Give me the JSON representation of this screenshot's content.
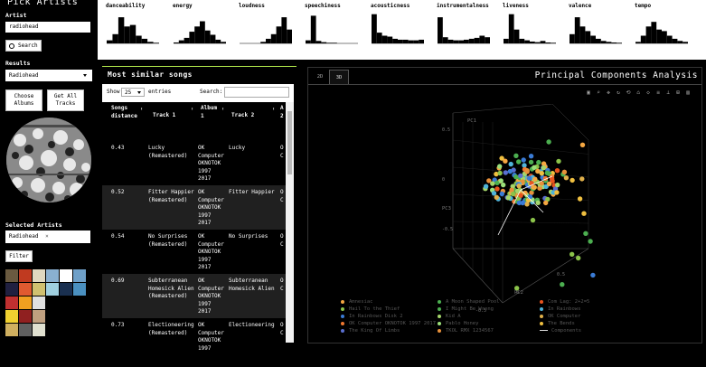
{
  "sidebar": {
    "title": "Pick Artists",
    "artist_label": "Artist",
    "artist_value": "radiohead",
    "search_button": "Search",
    "results_label": "Results",
    "results_selected": "Radiohead",
    "choose_albums": "Choose\nAlbums",
    "get_all_tracks": "Get All\nTracks",
    "selected_artists_label": "Selected Artists",
    "selected_artist_chip": "Radiohead",
    "chip_remove": "×",
    "filter_button": "Filter"
  },
  "histograms": [
    {
      "label": "danceability",
      "bins": [
        0.1,
        0.3,
        0.85,
        0.55,
        0.6,
        0.25,
        0.15,
        0.05,
        0.02
      ]
    },
    {
      "label": "energy",
      "bins": [
        0.03,
        0.1,
        0.18,
        0.38,
        0.55,
        0.72,
        0.42,
        0.28,
        0.12,
        0.05
      ]
    },
    {
      "label": "loudness",
      "bins": [
        0.0,
        0.0,
        0.0,
        0.0,
        0.05,
        0.15,
        0.3,
        0.55,
        0.85,
        0.45
      ]
    },
    {
      "label": "speechiness",
      "bins": [
        0.1,
        0.9,
        0.08,
        0.04,
        0.02,
        0.02,
        0.0,
        0.0,
        0.0,
        0.0
      ]
    },
    {
      "label": "acousticness",
      "bins": [
        0.95,
        0.35,
        0.25,
        0.22,
        0.15,
        0.12,
        0.12,
        0.1,
        0.1,
        0.12
      ]
    },
    {
      "label": "instrumentalness",
      "bins": [
        0.85,
        0.2,
        0.12,
        0.1,
        0.1,
        0.12,
        0.15,
        0.18,
        0.25,
        0.2
      ]
    },
    {
      "label": "liveness",
      "bins": [
        0.15,
        0.95,
        0.45,
        0.15,
        0.1,
        0.06,
        0.04,
        0.08,
        0.03,
        0.02
      ]
    },
    {
      "label": "valence",
      "bins": [
        0.3,
        0.85,
        0.55,
        0.4,
        0.25,
        0.15,
        0.08,
        0.05,
        0.03,
        0.02
      ]
    },
    {
      "label": "tempo",
      "bins": [
        0.05,
        0.25,
        0.55,
        0.7,
        0.45,
        0.4,
        0.25,
        0.15,
        0.08,
        0.05
      ]
    }
  ],
  "songs_panel": {
    "title": "Most similar songs",
    "show_label": "Show",
    "page_size": "25",
    "entries_label": "entries",
    "search_label": "Search:",
    "columns": [
      "Songs\ndistance",
      "Track 1",
      "Album\n1",
      "Track 2",
      "A\n2"
    ],
    "rows": [
      {
        "distance": "0.43",
        "track1": "Lucky\n(Remastered)",
        "album1": "OK\nComputer\nOKNOTOK\n1997\n2017",
        "track2": "Lucky",
        "album2": "O\nC"
      },
      {
        "distance": "0.52",
        "track1": "Fitter Happier\n(Remastered)",
        "album1": "OK\nComputer\nOKNOTOK\n1997\n2017",
        "track2": "Fitter Happier",
        "album2": "O\nC"
      },
      {
        "distance": "0.54",
        "track1": "No Surprises\n(Remastered)",
        "album1": "OK\nComputer\nOKNOTOK\n1997\n2017",
        "track2": "No Surprises",
        "album2": "O\nC"
      },
      {
        "distance": "0.69",
        "track1": "Subterranean\nHomesick Alien\n(Remastered)",
        "album1": "OK\nComputer\nOKNOTOK\n1997\n2017",
        "track2": "Subterranean\nHomesick Alien",
        "album2": "O\nC"
      },
      {
        "distance": "0.73",
        "track1": "Electioneering\n(Remastered)",
        "album1": "OK\nComputer\nOKNOTOK\n1997",
        "track2": "Electioneering",
        "album2": "O\nC"
      }
    ]
  },
  "pca": {
    "title": "Principal Components Analysis",
    "tabs": [
      "2D",
      "3D"
    ],
    "axis_pc1": "PC1",
    "axis_pc2": "PC2",
    "axis_pc3": "PC3",
    "legend": [
      {
        "label": "Amnesiac",
        "color": "#f5a742"
      },
      {
        "label": "A Moon Shaped Pool",
        "color": "#4caf50"
      },
      {
        "label": "Com Lag: 2+2=5",
        "color": "#e8541e"
      },
      {
        "label": "Hail To the Thief",
        "color": "#8bc34a"
      },
      {
        "label": "I Might Be Wrong",
        "color": "#4caf50"
      },
      {
        "label": "In Rainbows",
        "color": "#4fb3d9"
      },
      {
        "label": "In Rainbows Disk 2",
        "color": "#3a7bd5"
      },
      {
        "label": "Kid A",
        "color": "#a5d66b"
      },
      {
        "label": "OK Computer",
        "color": "#e0b04a"
      },
      {
        "label": "OK Computer OKNOTOK 1997 2017",
        "color": "#f07830"
      },
      {
        "label": "Pablo Honey",
        "color": "#9be07a"
      },
      {
        "label": "The Bends",
        "color": "#f0c040"
      },
      {
        "label": "The King Of Limbs",
        "color": "#5a6fd0"
      },
      {
        "label": "TKOL RMX 1234567",
        "color": "#e8903a"
      },
      {
        "label": "Components",
        "color": "#dddddd"
      }
    ]
  }
}
